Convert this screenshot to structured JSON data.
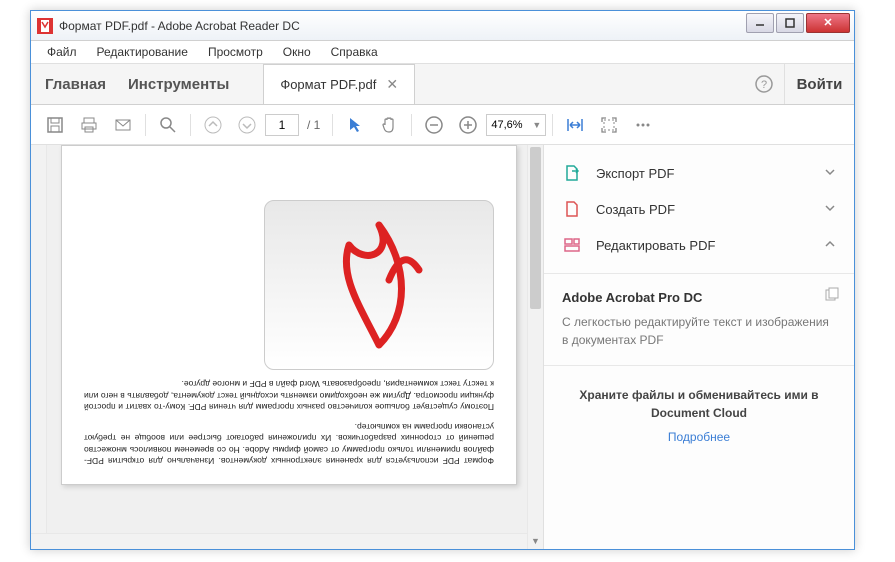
{
  "window": {
    "title": "Формат PDF.pdf - Adobe Acrobat Reader DC"
  },
  "menubar": [
    "Файл",
    "Редактирование",
    "Просмотр",
    "Окно",
    "Справка"
  ],
  "tabs": {
    "home": "Главная",
    "tools": "Инструменты",
    "file": "Формат PDF.pdf",
    "login": "Войти"
  },
  "toolbar": {
    "page_current": "1",
    "page_total": "/ 1",
    "zoom": "47,6%"
  },
  "document": {
    "para1": "Формат PDF используется для хранения электронных документов. Изначально для открытия PDF-файлов применяли только программу от самой фирмы Adobe. Но со временем появилось множество решений от сторонних разработчиков. Их приложения работают быстрее или вообще не требуют установки программ на компьютер.",
    "para2": "Поэтому существует большое количество разных программ для чтения PDF. Кому-то хватит и простой функции просмотра. Другим же необходимо изменять исходный текст документа, добавлять в него или к тексту текст комментария, преобразовать Word файл в PDF и многое другое."
  },
  "sidepanel": {
    "items": [
      {
        "label": "Экспорт PDF"
      },
      {
        "label": "Создать PDF"
      },
      {
        "label": "Редактировать PDF"
      }
    ],
    "info": {
      "title": "Adobe Acrobat Pro DC",
      "desc": "С легкостью редактируйте текст и изображения в документах PDF"
    },
    "promo": {
      "text": "Храните файлы и обменивайтесь ими в Document Cloud",
      "link": "Подробнее"
    }
  }
}
